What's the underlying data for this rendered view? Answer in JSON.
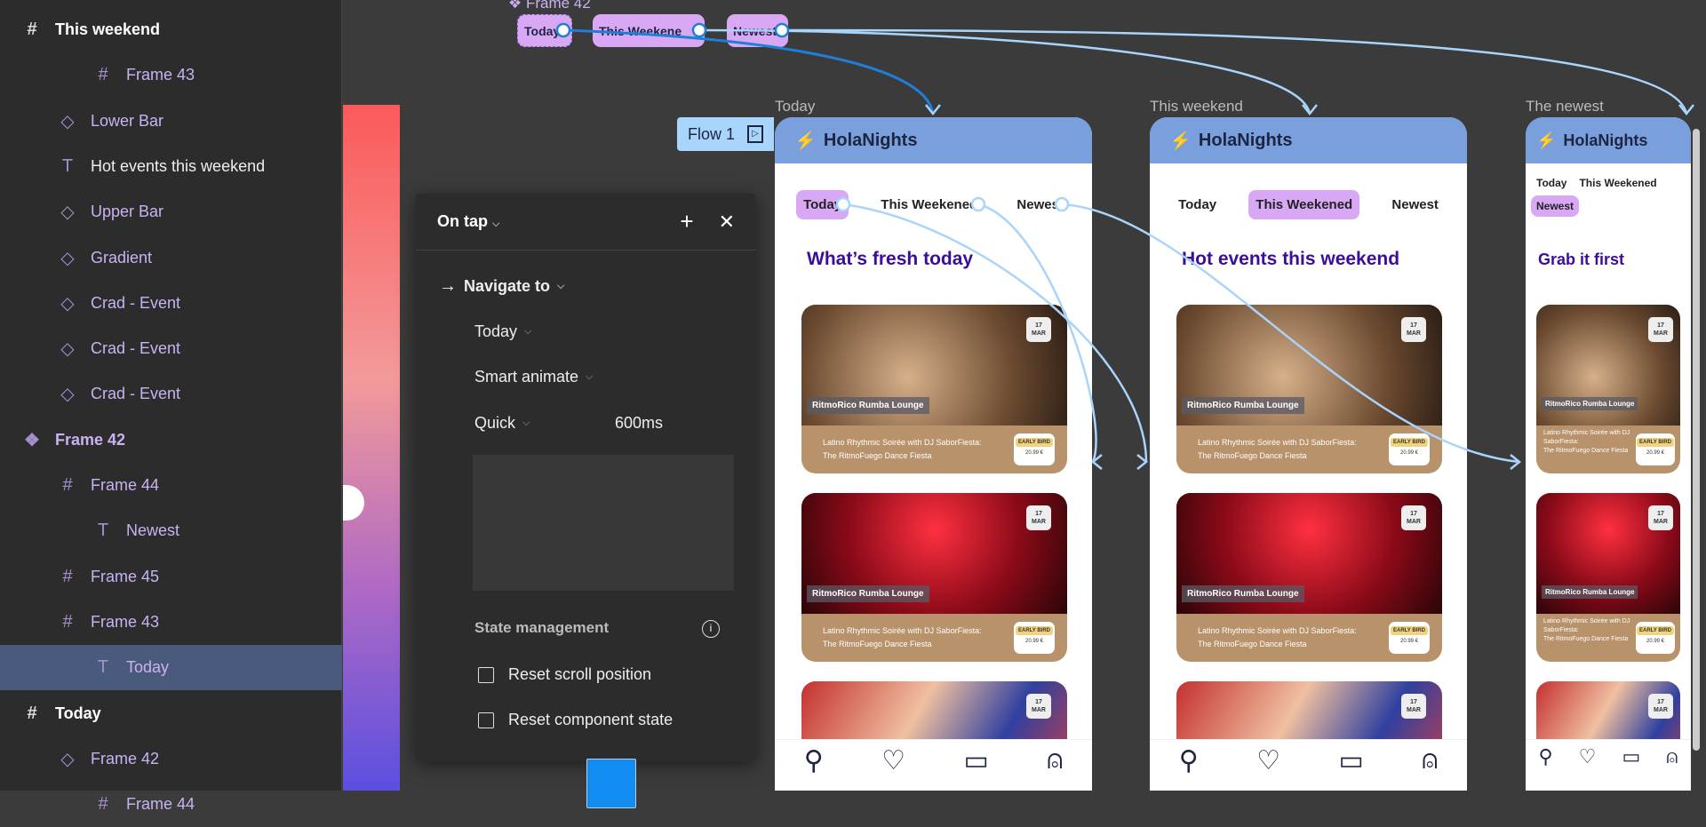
{
  "layers": [
    {
      "label": "This weekend",
      "icon": "frame",
      "style": "top"
    },
    {
      "label": "Frame 43",
      "icon": "frame",
      "style": "purple",
      "indent": 2
    },
    {
      "label": "Lower Bar",
      "icon": "component",
      "style": "purple",
      "indent": 1
    },
    {
      "label": "Hot events this weekend",
      "icon": "text",
      "style": "white",
      "indent": 1
    },
    {
      "label": "Upper Bar",
      "icon": "component",
      "style": "purple",
      "indent": 1
    },
    {
      "label": "Gradient",
      "icon": "component",
      "style": "purple",
      "indent": 1
    },
    {
      "label": "Crad - Event",
      "icon": "component",
      "style": "purple",
      "indent": 1
    },
    {
      "label": "Crad - Event",
      "icon": "component",
      "style": "purple",
      "indent": 1
    },
    {
      "label": "Crad - Event",
      "icon": "component",
      "style": "purple",
      "indent": 1
    },
    {
      "label": "Frame 42",
      "icon": "component-set",
      "style": "purple bold"
    },
    {
      "label": "Frame 44",
      "icon": "frame",
      "style": "purple",
      "indent": 1
    },
    {
      "label": "Newest",
      "icon": "text",
      "style": "purple",
      "indent": 2
    },
    {
      "label": "Frame 45",
      "icon": "frame",
      "style": "purple",
      "indent": 1
    },
    {
      "label": "Frame 43",
      "icon": "frame",
      "style": "purple",
      "indent": 1
    },
    {
      "label": "Today",
      "icon": "text",
      "style": "purple sel",
      "indent": 2
    },
    {
      "label": "Today",
      "icon": "frame",
      "style": "top"
    },
    {
      "label": "Frame 42",
      "icon": "component",
      "style": "purple",
      "indent": 1
    },
    {
      "label": "Frame 44",
      "icon": "frame",
      "style": "purple",
      "indent": 2
    }
  ],
  "canvas": {
    "component_label": "Frame 42",
    "chips": [
      "Today",
      "This Weekene",
      "Newest"
    ],
    "flow_label": "Flow 1"
  },
  "interaction": {
    "trigger": "On tap",
    "action": "Navigate to",
    "destination": "Today",
    "animation": "Smart animate",
    "easing": "Quick",
    "duration": "600ms",
    "state_title": "State management",
    "reset_scroll": "Reset scroll position",
    "reset_component": "Reset component state",
    "preview_color": "#118cf0"
  },
  "app": {
    "brand": "HolaNights",
    "tabs": [
      "Today",
      "This Weekened",
      "Newest"
    ],
    "card": {
      "venue": "RitmoRico Rumba Lounge",
      "day": "17",
      "month": "MAR",
      "desc1": "Latino Rhythmic Soirée with DJ SaborFiesta:",
      "desc2": "The RitmoFuego Dance Fiesta",
      "badge": "EARLY BIRD",
      "price": "20.99 €"
    }
  },
  "frames": [
    {
      "label": "Today",
      "title": "What’s fresh today",
      "active_tab": 0
    },
    {
      "label": "This weekend",
      "title": "Hot events this weekend",
      "active_tab": 1
    },
    {
      "label": "The newest",
      "title": "Grab it first",
      "active_tab": 2
    }
  ]
}
